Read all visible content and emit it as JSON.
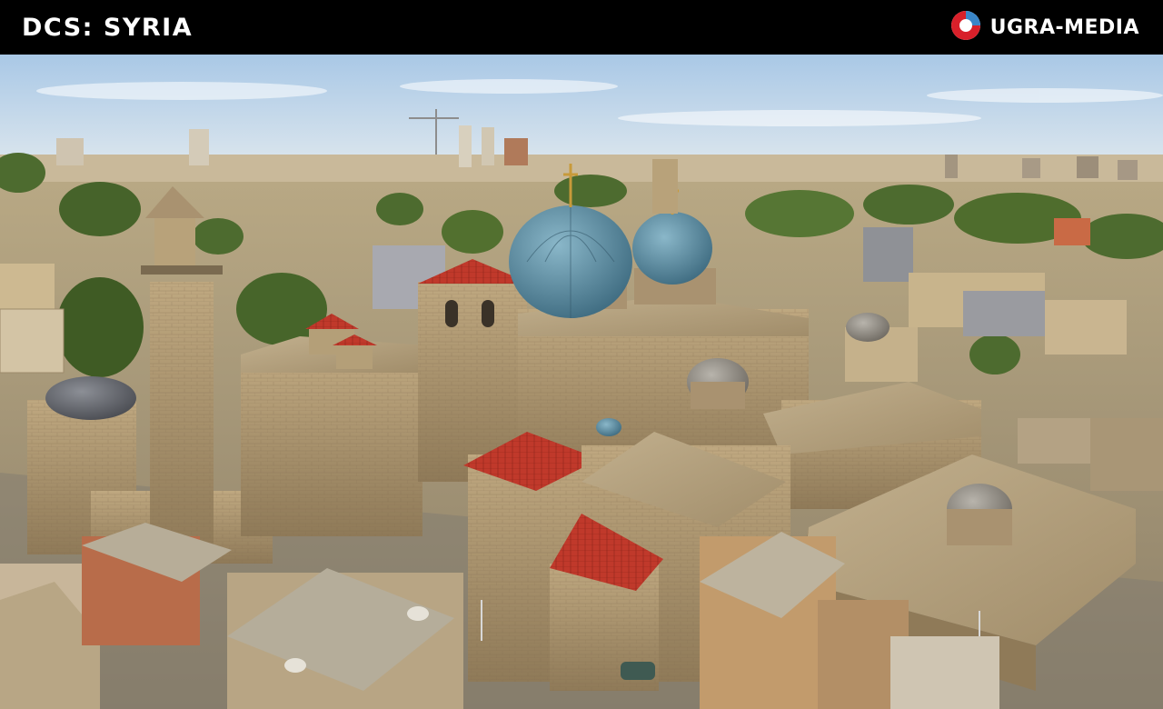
{
  "header": {
    "title": "DCS: SYRIA",
    "brand": "UGRA-MEDIA",
    "brand_logo_icon": "ugra-media-logo-icon"
  },
  "colors": {
    "banner_bg": "#000000",
    "banner_text": "#ffffff",
    "logo_red": "#d8202a",
    "logo_blue": "#3a86c8",
    "dome_teal": "#5d8fa6",
    "roof_red": "#c0392b",
    "stone": "#b49f78",
    "sky": "#b8d3ea"
  }
}
